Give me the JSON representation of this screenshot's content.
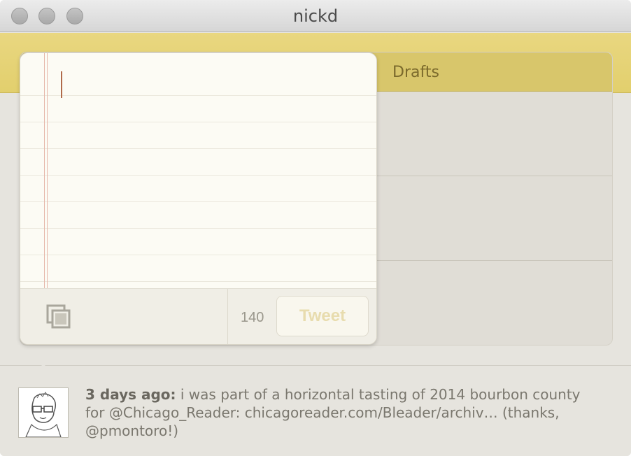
{
  "window": {
    "title": "nickd"
  },
  "tabs": {
    "drafts_label": "Drafts"
  },
  "compose": {
    "char_count": "140",
    "tweet_label": "Tweet"
  },
  "status": {
    "time": "3 days ago:",
    "text": " i was part of a horizontal tasting of 2014 bourbon county for @Chicago_Reader: chicagoreader.com/Bleader/archiv… (thanks, @pmontoro!)"
  },
  "icons": {
    "traffic": [
      "close-icon",
      "minimize-icon",
      "zoom-icon"
    ],
    "compose_left": "copy-icon"
  }
}
